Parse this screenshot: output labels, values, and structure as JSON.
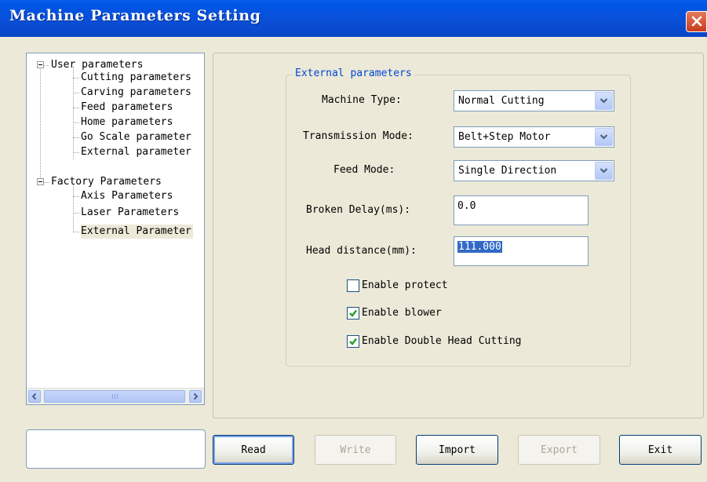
{
  "window": {
    "title": "Machine Parameters Setting"
  },
  "tree": {
    "groups": [
      {
        "label": "User parameters",
        "children": [
          "Cutting parameters",
          "Carving parameters",
          "Feed parameters",
          "Home parameters",
          "Go Scale parameter",
          "External parameter"
        ]
      },
      {
        "label": "Factory Parameters",
        "children": [
          "Axis Parameters",
          "Laser Parameters",
          "External Parameter"
        ]
      }
    ],
    "selected": "External Parameter"
  },
  "panel": {
    "group_title": "External parameters",
    "machine_type": {
      "label": "Machine Type:",
      "value": "Normal Cutting"
    },
    "transmission_mode": {
      "label": "Transmission Mode:",
      "value": "Belt+Step Motor"
    },
    "feed_mode": {
      "label": "Feed Mode:",
      "value": "Single Direction"
    },
    "broken_delay": {
      "label": "Broken Delay(ms):",
      "value": "0.0"
    },
    "head_distance": {
      "label": "Head distance(mm):",
      "value": "111.000"
    },
    "checkboxes": [
      {
        "label": "Enable protect",
        "checked": false
      },
      {
        "label": "Enable blower",
        "checked": true
      },
      {
        "label": "Enable Double Head Cutting",
        "checked": true
      }
    ]
  },
  "buttons": {
    "read": "Read",
    "write": "Write",
    "import": "Import",
    "export": "Export",
    "exit": "Exit"
  },
  "icons": {
    "close": "close-icon",
    "expander": "minus-icon",
    "dropdown": "chevron-down-icon",
    "check": "checkmark-icon",
    "scroll_left": "arrow-left-icon",
    "scroll_right": "arrow-right-icon"
  },
  "colors": {
    "titlebar": "#0A4FD8",
    "window_bg": "#ECE9D8",
    "group_title": "#0046D5",
    "selection": "#316AC5",
    "close_button": "#D3502E"
  }
}
